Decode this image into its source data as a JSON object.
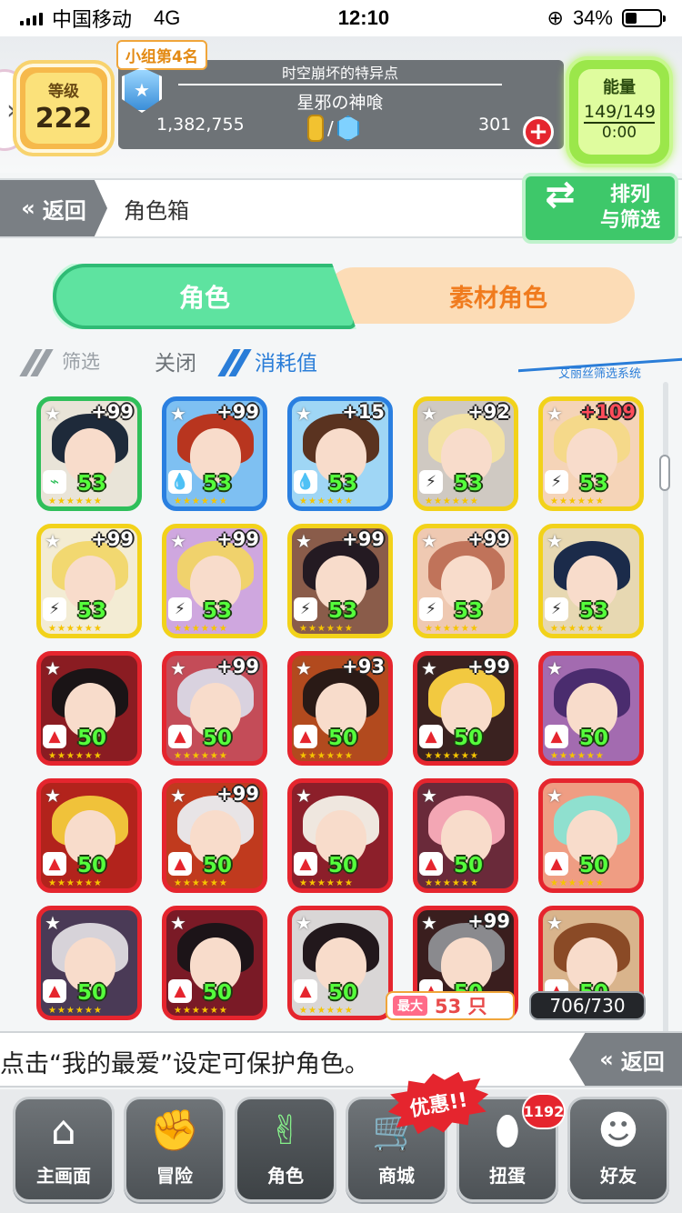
{
  "status_bar": {
    "carrier": "中国移动",
    "network": "4G",
    "time": "12:10",
    "battery": "34%",
    "battery_level": 0.34
  },
  "header": {
    "level_label": "等级",
    "level_value": "222",
    "group_rank": "小组第4名",
    "event_title": "时空崩坏的特异点",
    "event_subtitle": "星邪の神喰",
    "coins": "1,382,755",
    "separator": "/",
    "gems": "301",
    "plus": "+",
    "energy_label": "能量",
    "energy_value": "149/149",
    "energy_timer": "0:00"
  },
  "nav_bar": {
    "back_label": "返回",
    "page_title": "角色箱",
    "sort_filter_label_1": "排列",
    "sort_filter_label_2": "与筛选"
  },
  "tabs": {
    "character": "角色",
    "material": "素材角色"
  },
  "filter": {
    "label": "筛选",
    "state": "关闭",
    "sort": "消耗值",
    "system": "艾丽丝筛选系统"
  },
  "grid": {
    "cards": [
      {
        "plus": "+99",
        "level": "53",
        "rarity": "gold",
        "elem": "wind",
        "color": "#2fbf5a",
        "hair": "#1e2a3a",
        "bg": "#e9e4d8"
      },
      {
        "plus": "+99",
        "level": "53",
        "rarity": "gold",
        "elem": "water",
        "color": "#2a7fe0",
        "hair": "#b8351f",
        "bg": "#7ec0f2"
      },
      {
        "plus": "+15",
        "level": "53",
        "rarity": "gold",
        "elem": "water",
        "color": "#2a7fe0",
        "hair": "#5a3320",
        "bg": "#9fd6f5"
      },
      {
        "plus": "+92",
        "level": "53",
        "rarity": "gold",
        "elem": "thunder",
        "color": "#f2d21a",
        "hair": "#f3e2a4",
        "bg": "#cfc9c2"
      },
      {
        "plus": "+109",
        "level": "53",
        "rarity": "gold",
        "elem": "thunder",
        "color": "#f2d21a",
        "hair": "#f5d98a",
        "bg": "#f5d4b8",
        "plus_red": true
      },
      {
        "plus": "+99",
        "level": "53",
        "rarity": "gold",
        "elem": "thunder",
        "color": "#f2d21a",
        "hair": "#f2d870",
        "bg": "#f3ecd4"
      },
      {
        "plus": "+99",
        "level": "53",
        "rarity": "gold",
        "elem": "thunder",
        "color": "#f2d21a",
        "hair": "#f0d26c",
        "bg": "#cfa7df"
      },
      {
        "plus": "+99",
        "level": "53",
        "rarity": "gold",
        "elem": "thunder",
        "color": "#f2d21a",
        "hair": "#241a22",
        "bg": "#8a5c4a"
      },
      {
        "plus": "+99",
        "level": "53",
        "rarity": "gold",
        "elem": "thunder",
        "color": "#f2d21a",
        "hair": "#c0735a",
        "bg": "#efc9b2"
      },
      {
        "plus": "",
        "level": "53",
        "rarity": "gold",
        "elem": "thunder",
        "color": "#f2d21a",
        "hair": "#1b2b4a",
        "bg": "#e7d8b2"
      },
      {
        "plus": "",
        "level": "50",
        "rarity": "gold",
        "elem": "fire",
        "color": "#e5252e",
        "hair": "#1a1416",
        "bg": "#8a1c22"
      },
      {
        "plus": "+99",
        "level": "50",
        "rarity": "gold",
        "elem": "fire",
        "color": "#e5252e",
        "hair": "#d9d2df",
        "bg": "#c44c58"
      },
      {
        "plus": "+93",
        "level": "50",
        "rarity": "gold",
        "elem": "fire",
        "color": "#e5252e",
        "hair": "#2a1a16",
        "bg": "#b24a1e"
      },
      {
        "plus": "+99",
        "level": "50",
        "rarity": "gold",
        "elem": "fire",
        "color": "#e5252e",
        "hair": "#f2c940",
        "bg": "#3a2220"
      },
      {
        "plus": "",
        "level": "50",
        "rarity": "gold",
        "elem": "fire",
        "color": "#e5252e",
        "hair": "#4a2c6e",
        "bg": "#a36bb0"
      },
      {
        "plus": "",
        "level": "50",
        "rarity": "gold",
        "elem": "fire",
        "color": "#e5252e",
        "hair": "#f0c23a",
        "bg": "#b2231c"
      },
      {
        "plus": "+99",
        "level": "50",
        "rarity": "gold",
        "elem": "fire",
        "color": "#e5252e",
        "hair": "#e8e4e6",
        "bg": "#c03a1e"
      },
      {
        "plus": "",
        "level": "50",
        "rarity": "gold",
        "elem": "fire",
        "color": "#e5252e",
        "hair": "#efe7df",
        "bg": "#8c1f2a"
      },
      {
        "plus": "",
        "level": "50",
        "rarity": "gold",
        "elem": "fire",
        "color": "#e5252e",
        "hair": "#f3a6b4",
        "bg": "#6a2a3a"
      },
      {
        "plus": "",
        "level": "50",
        "rarity": "gold",
        "elem": "fire",
        "color": "#e5252e",
        "hair": "#8fe0cf",
        "bg": "#ef9d83"
      },
      {
        "plus": "",
        "level": "50",
        "rarity": "gold",
        "elem": "fire",
        "color": "#e5252e",
        "hair": "#d7d3d9",
        "bg": "#4a3a56"
      },
      {
        "plus": "",
        "level": "50",
        "rarity": "gold",
        "elem": "fire",
        "color": "#e5252e",
        "hair": "#1c1418",
        "bg": "#7a1a26"
      },
      {
        "plus": "",
        "level": "50",
        "rarity": "gold",
        "elem": "fire",
        "color": "#e5252e",
        "hair": "#22181c",
        "bg": "#d9d6d6"
      },
      {
        "plus": "+99",
        "level": "50",
        "rarity": "gold",
        "elem": "fire",
        "color": "#e5252e",
        "hair": "#8a8a8e",
        "bg": "#3a1e1e"
      },
      {
        "plus": "",
        "level": "50",
        "rarity": "gold",
        "elem": "fire",
        "color": "#e5252e",
        "hair": "#8a4a26",
        "bg": "#d9b48c"
      }
    ],
    "max_tag": "最大",
    "max_count": "53 只",
    "box_count": "706/730"
  },
  "tip": {
    "text": "点击“我的最爱”设定可保护角色。",
    "back_label": "返回"
  },
  "bottom_nav": [
    {
      "label": "主画面",
      "icon": "home-icon",
      "glyph": "⌂"
    },
    {
      "label": "冒险",
      "icon": "handshake-icon",
      "glyph": "✊"
    },
    {
      "label": "角色",
      "icon": "bunny-icon",
      "glyph": "✌",
      "active": true
    },
    {
      "label": "商城",
      "icon": "cart-icon",
      "glyph": "🛒"
    },
    {
      "label": "扭蛋",
      "icon": "egg-icon",
      "glyph": "⬮"
    },
    {
      "label": "好友",
      "icon": "friends-icon",
      "glyph": "☻"
    }
  ],
  "badges": {
    "sale": "优惠!!",
    "gacha_count": "1192"
  },
  "colors": {
    "accent_green": "#5ee3a0",
    "accent_orange": "#f07b1e",
    "header_gray": "#6e7377"
  }
}
